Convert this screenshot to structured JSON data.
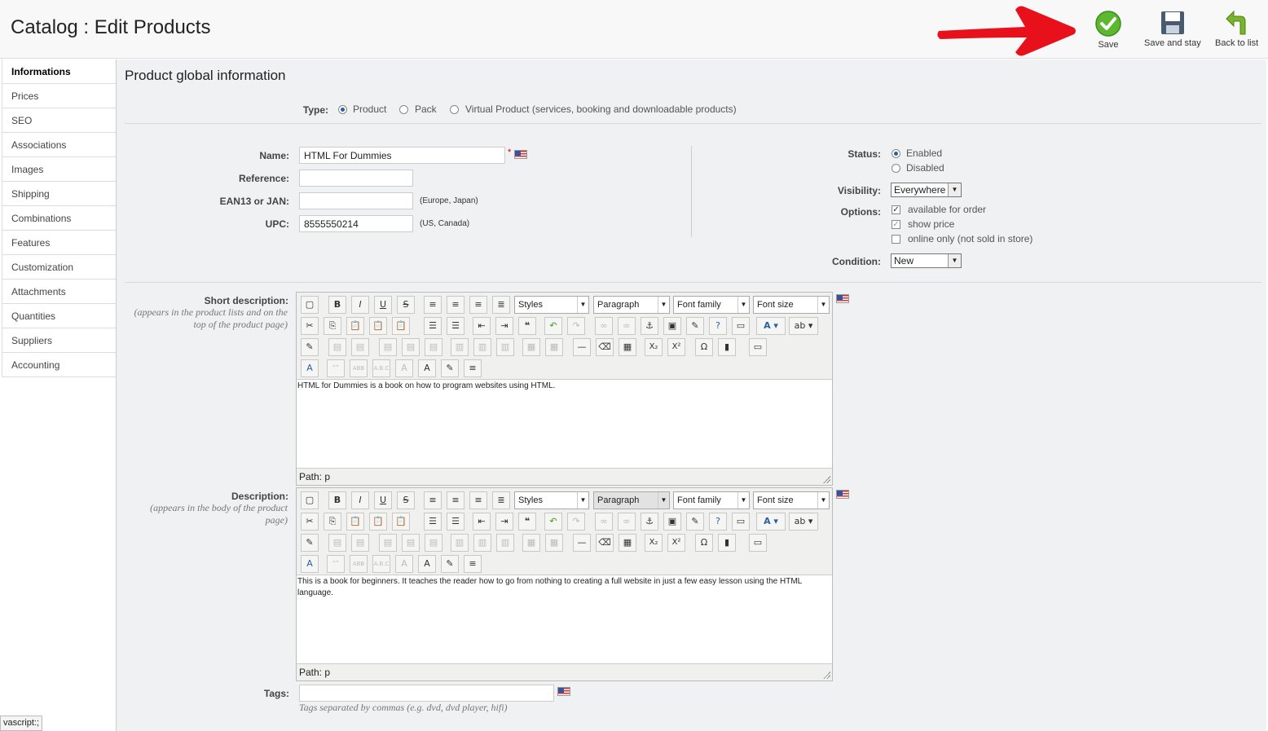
{
  "header": {
    "title": "Catalog : Edit Products",
    "save_label": "Save",
    "save_stay_label": "Save and stay",
    "back_label": "Back to list"
  },
  "sidebar": {
    "items": [
      {
        "label": "Informations"
      },
      {
        "label": "Prices"
      },
      {
        "label": "SEO"
      },
      {
        "label": "Associations"
      },
      {
        "label": "Images"
      },
      {
        "label": "Shipping"
      },
      {
        "label": "Combinations"
      },
      {
        "label": "Features"
      },
      {
        "label": "Customization"
      },
      {
        "label": "Attachments"
      },
      {
        "label": "Quantities"
      },
      {
        "label": "Suppliers"
      },
      {
        "label": "Accounting"
      }
    ]
  },
  "main": {
    "section_title": "Product global information",
    "type": {
      "label": "Type:",
      "options": [
        "Product",
        "Pack",
        "Virtual Product (services, booking and downloadable products)"
      ],
      "selected": "Product"
    },
    "name": {
      "label": "Name:",
      "value": "HTML For Dummies",
      "required": "*"
    },
    "reference": {
      "label": "Reference:",
      "value": ""
    },
    "ean": {
      "label": "EAN13 or JAN:",
      "value": "",
      "note": "(Europe, Japan)"
    },
    "upc": {
      "label": "UPC:",
      "value": "8555550214",
      "note": "(US, Canada)"
    },
    "status": {
      "label": "Status:",
      "enabled": "Enabled",
      "disabled": "Disabled"
    },
    "visibility": {
      "label": "Visibility:",
      "value": "Everywhere"
    },
    "options": {
      "label": "Options:",
      "available": "available for order",
      "show_price": "show price",
      "online_only": "online only (not sold in store)"
    },
    "condition": {
      "label": "Condition:",
      "value": "New"
    },
    "short_desc": {
      "label": "Short description:",
      "hint": "(appears in the product lists and on the top of the product page)",
      "content": "HTML for Dummies is a book on how to program websites using HTML.",
      "path": "Path: p"
    },
    "description": {
      "label": "Description:",
      "hint": "(appears in the body of the product page)",
      "content": "This is a book for beginners. It teaches the reader how to go from nothing to creating a full website in just a few easy lesson using the HTML language.",
      "path": "Path: p"
    },
    "editor_toolbar": {
      "styles": "Styles",
      "paragraph": "Paragraph",
      "font_family": "Font family",
      "font_size": "Font size"
    },
    "tags": {
      "label": "Tags:",
      "value": "",
      "hint": "Tags separated by commas (e.g. dvd, dvd player, hifi)"
    }
  },
  "statusbar": {
    "text": "vascript:;"
  },
  "colors": {
    "accent_green": "#3a9d23",
    "arrow_red": "#e8101a",
    "main_bg": "#eff1f2"
  }
}
